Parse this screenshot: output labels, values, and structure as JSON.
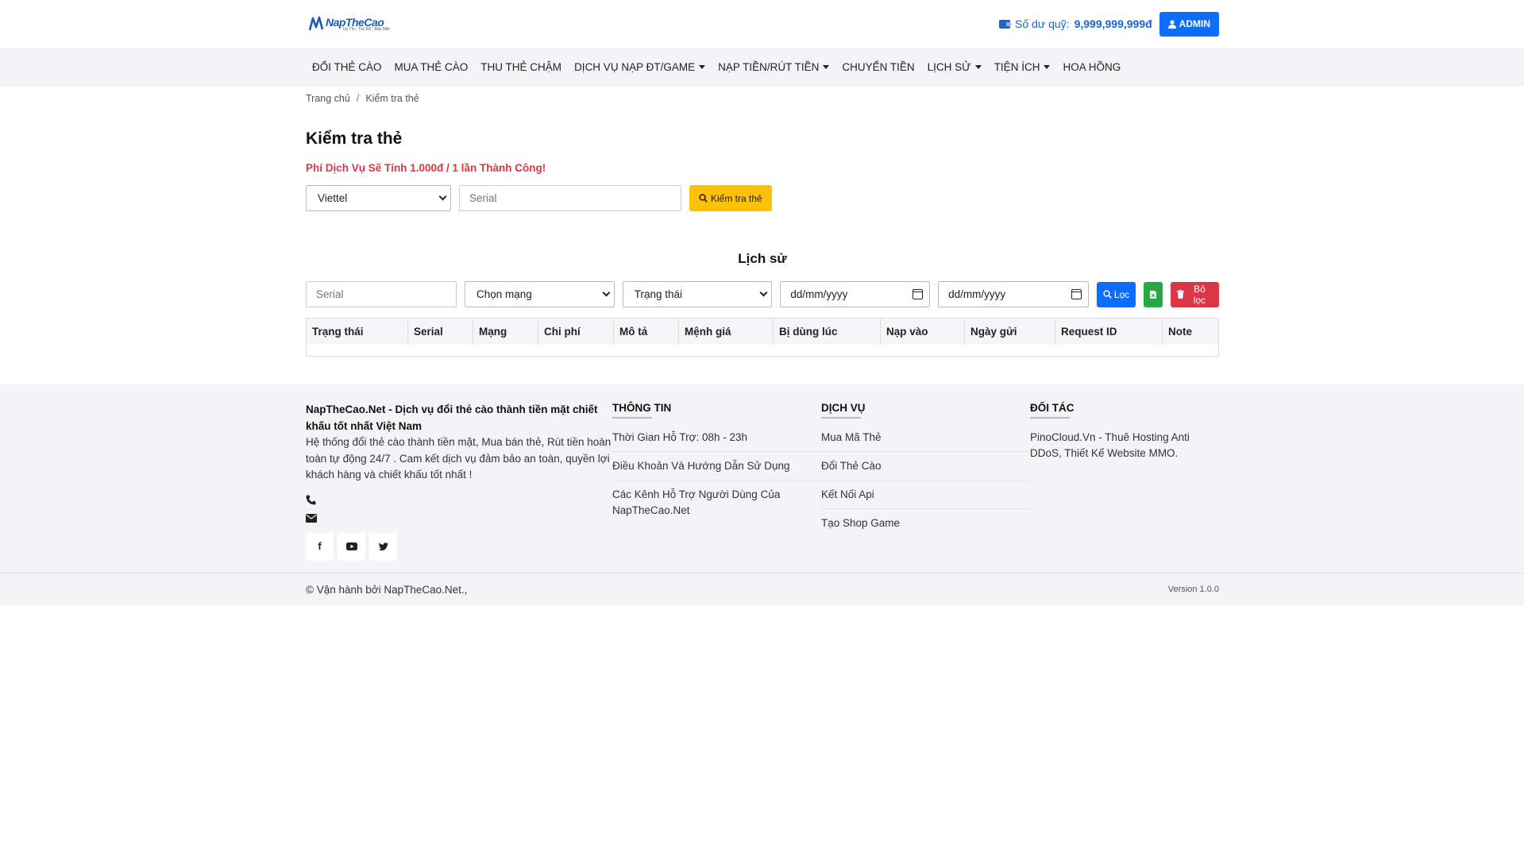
{
  "header": {
    "logo_brand": "NapTheCao",
    "logo_tagline": "Uy Tín - Tốc Độ - Bảo Mật",
    "balance_label": "Số dư quỹ:",
    "balance_value": "9,999,999,999đ",
    "admin_label": "ADMIN"
  },
  "nav": {
    "items": [
      {
        "label": "ĐỔI THẺ CÀO",
        "dropdown": false
      },
      {
        "label": "MUA THẺ CÀO",
        "dropdown": false
      },
      {
        "label": "THU THẺ CHẬM",
        "dropdown": false
      },
      {
        "label": "DỊCH VỤ NẠP ĐT/GAME",
        "dropdown": true
      },
      {
        "label": "NẠP TIỀN/RÚT TIỀN",
        "dropdown": true
      },
      {
        "label": "CHUYỂN TIỀN",
        "dropdown": false
      },
      {
        "label": "LỊCH SỬ",
        "dropdown": true
      },
      {
        "label": "TIỆN ÍCH",
        "dropdown": true
      },
      {
        "label": "HOA HỒNG",
        "dropdown": false
      }
    ]
  },
  "breadcrumb": {
    "home": "Trang chủ",
    "separator": "/",
    "current": "Kiểm tra thẻ"
  },
  "check": {
    "title": "Kiểm tra thẻ",
    "fee_note": "Phí Dịch Vụ Sẽ Tính 1.000đ / 1 lần Thành Công!",
    "network_selected": "Viettel",
    "serial_placeholder": "Serial",
    "submit_label": "Kiểm tra thẻ"
  },
  "history": {
    "title": "Lịch sử",
    "serial_placeholder": "Serial",
    "network_selected": "Chọn mạng",
    "status_selected": "Trạng thái",
    "date_from_placeholder": "dd/mm/yyyy",
    "date_to_placeholder": "dd/mm/yyyy",
    "filter_label": "Lọc",
    "clear_label": "Bỏ lọc",
    "columns": [
      "Trạng thái",
      "Serial",
      "Mạng",
      "Chi phí",
      "Mô tả",
      "Mệnh giá",
      "Bị dùng lúc",
      "Nạp vào",
      "Ngày gửi",
      "Request ID",
      "Note"
    ]
  },
  "footer": {
    "about_heading": "NapTheCao.Net - Dịch vụ đổi thẻ cào thành tiền mặt chiết khấu tốt nhất Việt Nam",
    "about_text": "Hệ thống đổi thẻ cào thành tiền mặt, Mua bán thẻ, Rút tiền hoàn toàn tự động 24/7 . Cam kết dịch vụ đảm bảo an toàn, quyền lợi khách hàng và chiết khấu tốt nhất !",
    "info_title": "THÔNG TIN",
    "info_links": [
      "Thời Gian Hỗ Trợ: 08h - 23h",
      "Điều Khoản Và Hướng Dẫn Sử Dụng",
      "Các Kênh Hỗ Trợ Người Dùng Của NapTheCao.Net"
    ],
    "service_title": "DỊCH VỤ",
    "service_links": [
      "Mua Mã Thẻ",
      "Đổi Thẻ Cào",
      "Kết Nối Api",
      "Tạo Shop Game"
    ],
    "partner_title": "ĐỐI TÁC",
    "partner_text": "PinoCloud.Vn - Thuê Hosting Anti DDoS, Thiết Kế Website MMO.",
    "copyright": "© Vận hành bởi NapTheCao.Net.,",
    "version": "Version 1.0.0"
  },
  "colors": {
    "primary": "#0d6efd",
    "warning": "#ffc107",
    "success": "#28a745",
    "danger": "#dc3545",
    "nav_bg": "#f3f4f6"
  }
}
